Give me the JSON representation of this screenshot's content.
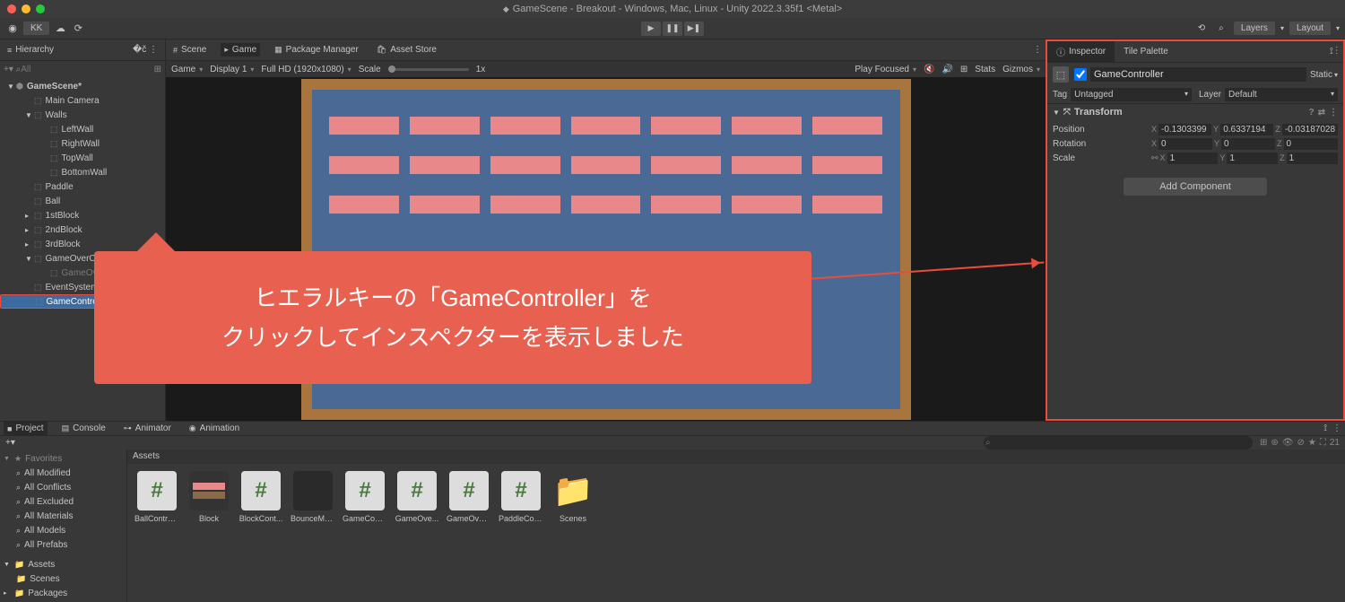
{
  "titlebar": {
    "text": "GameScene - Breakout - Windows, Mac, Linux - Unity 2022.3.35f1 <Metal>"
  },
  "toolbar": {
    "account": "KK",
    "layers": "Layers",
    "layout": "Layout"
  },
  "hierarchy": {
    "title": "Hierarchy",
    "search_placeholder": "All",
    "scene": "GameScene*",
    "items": [
      {
        "name": "Main Camera",
        "indent": 28
      },
      {
        "name": "Walls",
        "indent": 28,
        "expand": true
      },
      {
        "name": "LeftWall",
        "indent": 46
      },
      {
        "name": "RightWall",
        "indent": 46
      },
      {
        "name": "TopWall",
        "indent": 46
      },
      {
        "name": "BottomWall",
        "indent": 46
      },
      {
        "name": "Paddle",
        "indent": 28
      },
      {
        "name": "Ball",
        "indent": 28
      },
      {
        "name": "1stBlock",
        "indent": 28,
        "collapsed": true
      },
      {
        "name": "2ndBlock",
        "indent": 28,
        "collapsed": true
      },
      {
        "name": "3rdBlock",
        "indent": 28,
        "collapsed": true
      },
      {
        "name": "GameOverCanvas",
        "indent": 28,
        "expand": true
      },
      {
        "name": "GameOverText",
        "indent": 46,
        "dim": true
      },
      {
        "name": "EventSystem",
        "indent": 28
      },
      {
        "name": "GameController",
        "indent": 28,
        "selected": true
      }
    ]
  },
  "center_tabs": {
    "scene": "Scene",
    "game": "Game",
    "package": "Package Manager",
    "asset_store": "Asset Store"
  },
  "game_toolbar": {
    "game": "Game",
    "display": "Display 1",
    "resolution": "Full HD (1920x1080)",
    "scale": "Scale",
    "scale_val": "1x",
    "play_focused": "Play Focused",
    "stats": "Stats",
    "gizmos": "Gizmos"
  },
  "inspector": {
    "tab_inspector": "Inspector",
    "tab_tile": "Tile Palette",
    "name": "GameController",
    "static": "Static",
    "tag_label": "Tag",
    "tag_val": "Untagged",
    "layer_label": "Layer",
    "layer_val": "Default",
    "transform": {
      "title": "Transform",
      "position": {
        "label": "Position",
        "x": "-0.1303399",
        "y": "0.6337194",
        "z": "-0.03187028"
      },
      "rotation": {
        "label": "Rotation",
        "x": "0",
        "y": "0",
        "z": "0"
      },
      "scale": {
        "label": "Scale",
        "x": "1",
        "y": "1",
        "z": "1"
      }
    },
    "add_component": "Add Component"
  },
  "project": {
    "tabs": {
      "project": "Project",
      "console": "Console",
      "animator": "Animator",
      "animation": "Animation"
    },
    "count": "21",
    "tree": {
      "favorites": "Favorites",
      "fav_items": [
        "All Modified",
        "All Conflicts",
        "All Excluded",
        "All Materials",
        "All Models",
        "All Prefabs"
      ],
      "assets": "Assets",
      "asset_items": [
        "Scenes"
      ],
      "packages": "Packages"
    },
    "breadcrumb": "Assets",
    "assets": [
      {
        "name": "BallControl...",
        "type": "cs"
      },
      {
        "name": "Block",
        "type": "block"
      },
      {
        "name": "BlockCont...",
        "type": "cs"
      },
      {
        "name": "BounceMa...",
        "type": "ball"
      },
      {
        "name": "GameCont...",
        "type": "cs"
      },
      {
        "name": "GameOve...",
        "type": "cs"
      },
      {
        "name": "GameOver...",
        "type": "cs"
      },
      {
        "name": "PaddleCon...",
        "type": "cs"
      },
      {
        "name": "Scenes",
        "type": "folder"
      }
    ]
  },
  "callout": {
    "line1": "ヒエラルキーの「GameController」を",
    "line2": "クリックしてインスペクターを表示しました"
  }
}
